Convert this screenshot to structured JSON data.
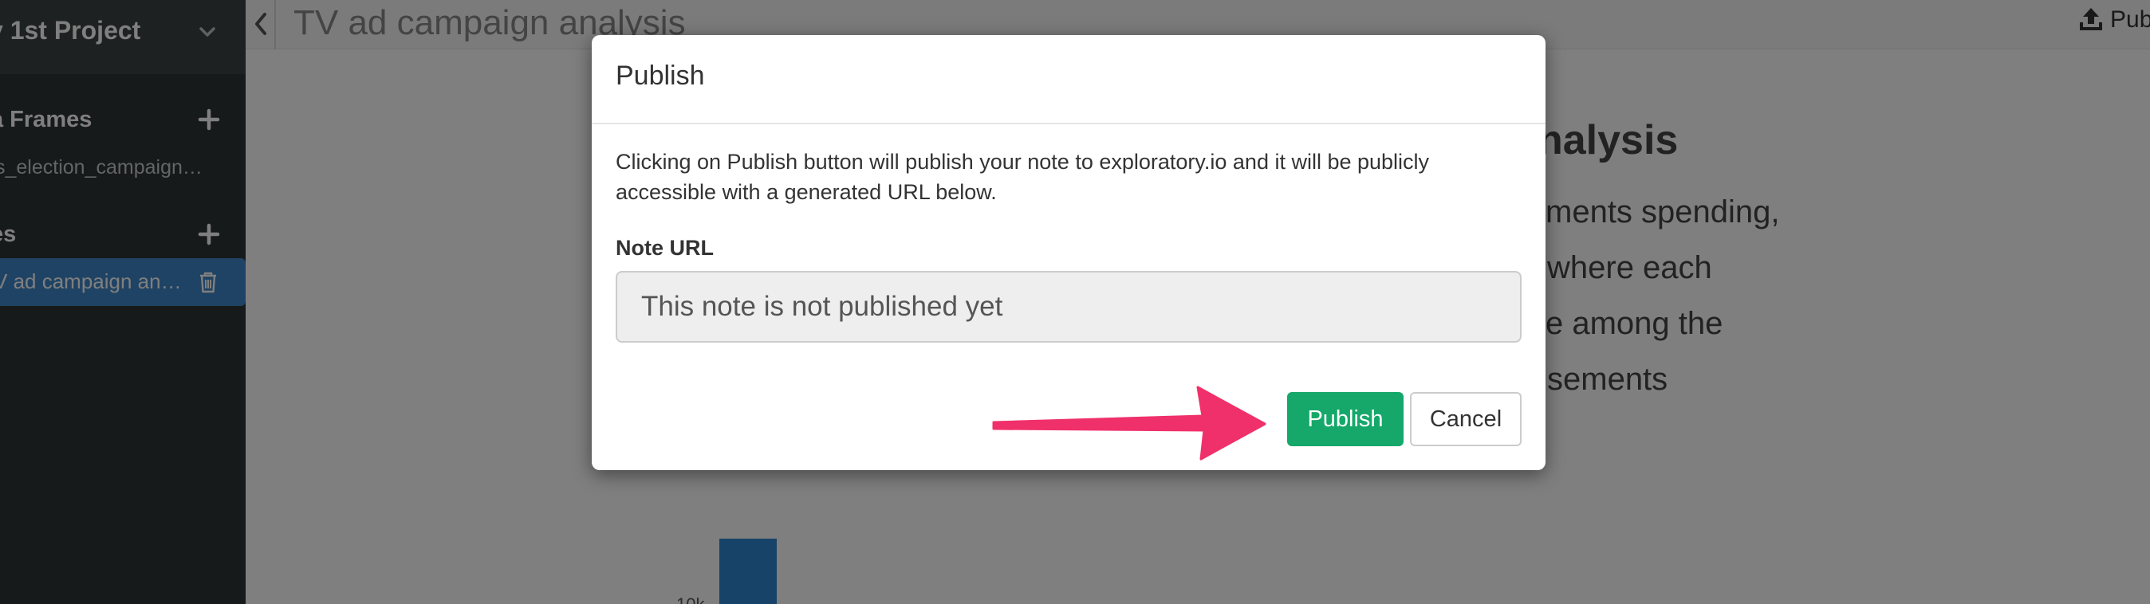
{
  "sidebar": {
    "project_name": "y 1st Project",
    "sections": [
      {
        "label": "a Frames",
        "items": [
          "s_election_campaign…"
        ]
      },
      {
        "label": "es",
        "items": [
          "V ad campaign an…"
        ]
      }
    ]
  },
  "header": {
    "title": "TV ad campaign analysis",
    "publish_label": "Publ"
  },
  "background_note": {
    "heading": "nalysis",
    "lines": [
      "ments spending,",
      "where each",
      "e among the",
      "sements"
    ],
    "axis_tick": "10k"
  },
  "modal": {
    "title": "Publish",
    "description": "Clicking on Publish button will publish your note to exploratory.io and it will be publicly accessible with a generated URL below.",
    "field_label": "Note URL",
    "url_placeholder": "This note is not published yet",
    "publish_button": "Publish",
    "cancel_button": "Cancel"
  },
  "colors": {
    "sidebar_bg": "#2f3434",
    "active_item": "#3e86c8",
    "publish_green": "#15a86a",
    "annotation_arrow": "#f0306a"
  },
  "icons": [
    "chevron-down-icon",
    "plus-icon",
    "trash-icon",
    "chevron-left-icon",
    "upload-icon",
    "arrow-annotation-icon"
  ]
}
